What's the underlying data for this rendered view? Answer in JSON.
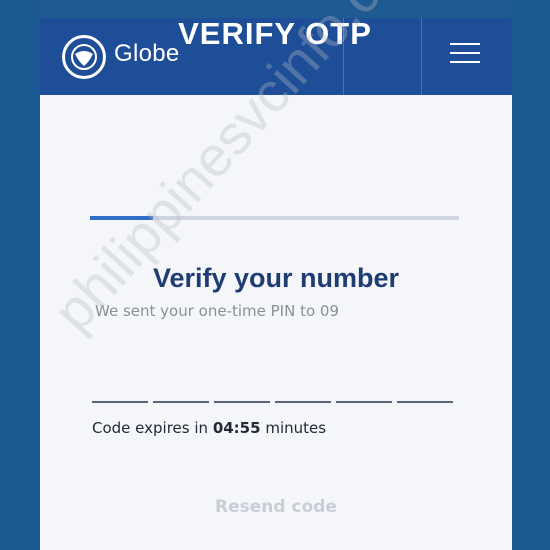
{
  "header": {
    "brand": "Globe",
    "logo_icon": "globe-logo-icon",
    "menu_icon": "hamburger-menu-icon"
  },
  "overlay_title": "VERIFY OTP",
  "page": {
    "heading": "Verify your number",
    "subtext": "We sent your one-time PIN to 09",
    "progress_fraction": 0.17,
    "otp_digits": [
      "",
      "",
      "",
      "",
      "",
      ""
    ],
    "expires_prefix": "Code expires in",
    "expires_time": "04:55",
    "expires_suffix": "minutes",
    "resend_label": "Resend code"
  },
  "watermark": "philippinesvcinfo.com",
  "colors": {
    "header_bg": "#1e4e97",
    "accent": "#2f6fc9",
    "heading": "#1f3c73"
  }
}
